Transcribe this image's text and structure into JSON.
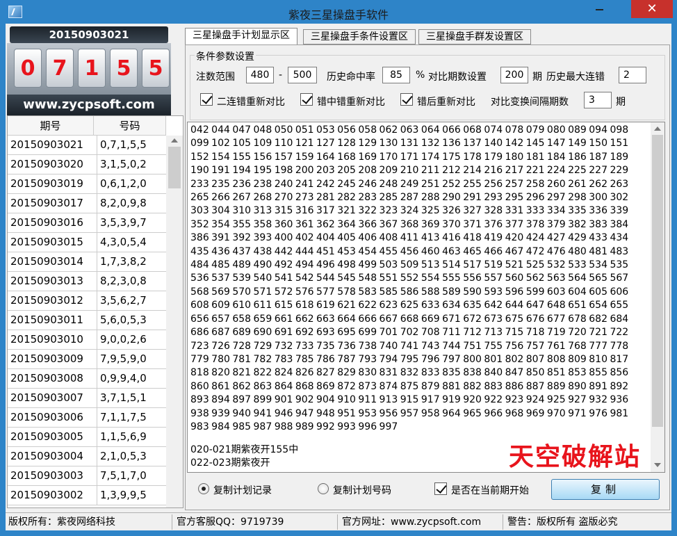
{
  "window": {
    "title": "紫夜三星操盘手软件",
    "close_label": "✕"
  },
  "left": {
    "date": "20150903021",
    "digits": [
      "0",
      "7",
      "1",
      "5",
      "5"
    ],
    "website_banner": "www.zycpsoft.com",
    "table": {
      "headers": [
        "期号",
        "号码"
      ],
      "rows": [
        [
          "20150903021",
          "0,7,1,5,5"
        ],
        [
          "20150903020",
          "3,1,5,0,2"
        ],
        [
          "20150903019",
          "0,6,1,2,0"
        ],
        [
          "20150903017",
          "8,2,0,9,8"
        ],
        [
          "20150903016",
          "3,5,3,9,7"
        ],
        [
          "20150903015",
          "4,3,0,5,4"
        ],
        [
          "20150903014",
          "1,7,3,8,2"
        ],
        [
          "20150903013",
          "8,2,3,0,8"
        ],
        [
          "20150903012",
          "3,5,6,2,7"
        ],
        [
          "20150903011",
          "5,6,0,5,3"
        ],
        [
          "20150903010",
          "9,0,0,2,6"
        ],
        [
          "20150903009",
          "7,9,5,9,0"
        ],
        [
          "20150903008",
          "0,9,9,4,0"
        ],
        [
          "20150903007",
          "3,7,1,5,1"
        ],
        [
          "20150903006",
          "7,1,1,7,5"
        ],
        [
          "20150903005",
          "1,1,5,6,9"
        ],
        [
          "20150903004",
          "2,1,0,5,3"
        ],
        [
          "20150903003",
          "7,5,1,7,0"
        ],
        [
          "20150903002",
          "1,3,9,9,5"
        ]
      ]
    }
  },
  "tabs": [
    {
      "label": "三星操盘手计划显示区",
      "active": true
    },
    {
      "label": "三星操盘手条件设置区",
      "active": false
    },
    {
      "label": "三星操盘手群发设置区",
      "active": false
    }
  ],
  "params": {
    "legend": "条件参数设置",
    "range_label": "注数范围",
    "range_min": "480",
    "range_sep": "-",
    "range_max": "500",
    "hit_rate_label": "历史命中率",
    "hit_rate": "85",
    "percent": "%",
    "compare_label": "对比期数设置",
    "compare_periods": "200",
    "period_unit": "期",
    "max_miss_label": "历史最大连错",
    "max_miss": "2",
    "check1": "二连错重新对比",
    "check2": "错中错重新对比",
    "check3": "错后重新对比",
    "interval_label": "对比变换间隔期数",
    "interval": "3",
    "interval_unit": "期"
  },
  "results": {
    "numbers": "042 044 047 048 050 051 053 056 058 062 063 064 066 068 074 078 079 080 089 094 098 099 102 105 109 110 121 127 128 129 130 131 132 136 137 140 142 145 147 149 150 151 152 154 155 156 157 159 164 168 169 170 171 174 175 178 179 180 181 184 186 187 189 190 191 194 195 198 200 203 205 208 209 210 211 212 214 216 217 221 224 225 227 229 233 235 236 238 240 241 242 245 246 248 249 251 252 255 256 257 258 260 261 262 263 265 266 267 268 270 273 281 282 283 285 287 288 290 291 293 295 296 297 298 300 302 303 304 310 313 315 316 317 321 322 323 324 325 326 327 328 331 333 334 335 336 339 352 354 355 358 360 361 362 364 366 367 368 369 370 371 376 377 378 379 382 383 384 386 391 392 393 400 402 404 405 406 408 411 413 416 418 419 420 424 427 429 433 434 435 436 437 438 442 444 451 453 454 455 456 460 463 465 466 467 472 476 480 481 483 484 485 489 490 492 494 496 498 499 503 509 513 514 517 519 521 525 532 533 534 535 536 537 539 540 541 542 544 545 548 551 552 554 555 556 557 560 562 563 564 565 567 568 569 570 571 572 576 577 578 583 585 586 588 589 590 593 596 599 603 604 605 606 608 609 610 611 615 618 619 621 622 623 625 633 634 635 642 644 647 648 651 654 655 656 657 658 659 661 662 663 664 666 667 668 669 671 672 673 675 676 677 678 682 684 686 687 689 690 691 692 693 695 699 701 702 708 711 712 713 715 718 719 720 721 722 723 726 728 729 732 733 735 736 738 740 741 743 744 751 755 756 757 761 768 777 778 779 780 781 782 783 785 786 787 793 794 795 796 797 800 801 802 807 808 809 810 817 818 820 821 822 824 826 827 829 830 831 832 833 835 838 840 847 850 851 853 855 856 860 861 862 863 864 868 869 872 873 874 875 879 881 882 883 886 887 889 890 891 892 893 894 897 899 901 902 904 910 911 913 915 917 919 920 922 923 924 925 927 932 936 938 939 940 941 946 947 948 951 953 956 957 958 964 965 966 968 969 970 971 976 981 983 984 985 987 988 989 992 993 996 997",
    "line1": "020-021期紫夜开155中",
    "line2": "022-023期紫夜开",
    "watermark": "天空破解站"
  },
  "controls": {
    "radio1": "复制计划记录",
    "radio2": "复制计划号码",
    "check": "是否在当前期开始",
    "copy_button": "复制"
  },
  "status": [
    "版权所有：紫夜网络科技",
    "官方客服QQ：9719739",
    "官方网址：www.zycpsoft.com",
    "警告：版权所有 盗版必究"
  ]
}
